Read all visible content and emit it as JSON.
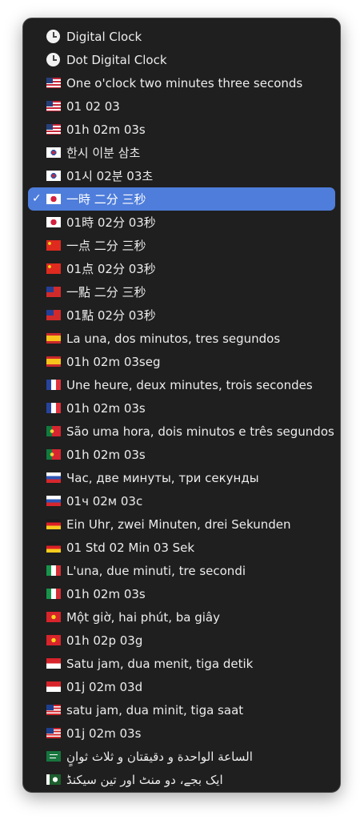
{
  "menu": {
    "check_glyph": "✓",
    "selected_index": 7,
    "accent_color": "#4e7ddb",
    "items": [
      {
        "label": "Digital Clock",
        "icon": "clock-icon"
      },
      {
        "label": "Dot Digital Clock",
        "icon": "clock-icon"
      },
      {
        "label": "One o'clock two minutes three seconds",
        "icon": "flag-us-icon"
      },
      {
        "label": "01 02 03",
        "icon": "flag-us-icon"
      },
      {
        "label": "01h 02m 03s",
        "icon": "flag-us-icon"
      },
      {
        "label": "한시 이분 삼초",
        "icon": "flag-kr-icon"
      },
      {
        "label": "01시 02분 03초",
        "icon": "flag-kr-icon"
      },
      {
        "label": "一時 二分 三秒",
        "icon": "flag-jp-icon"
      },
      {
        "label": "01時 02分 03秒",
        "icon": "flag-jp-icon"
      },
      {
        "label": "一点 二分 三秒",
        "icon": "flag-cn-icon"
      },
      {
        "label": "01点 02分 03秒",
        "icon": "flag-cn-icon"
      },
      {
        "label": "一點 二分 三秒",
        "icon": "flag-tw-icon"
      },
      {
        "label": "01點 02分 03秒",
        "icon": "flag-tw-icon"
      },
      {
        "label": "La una, dos minutos, tres segundos",
        "icon": "flag-es-icon"
      },
      {
        "label": "01h 02m 03seg",
        "icon": "flag-es-icon"
      },
      {
        "label": "Une heure, deux minutes, trois secondes",
        "icon": "flag-fr-icon"
      },
      {
        "label": "01h 02m 03s",
        "icon": "flag-fr-icon"
      },
      {
        "label": "São uma hora, dois minutos e três segundos",
        "icon": "flag-pt-icon"
      },
      {
        "label": "01h 02m 03s",
        "icon": "flag-pt-icon"
      },
      {
        "label": "Час, две минуты, три секунды",
        "icon": "flag-ru-icon"
      },
      {
        "label": "01ч 02м 03с",
        "icon": "flag-ru-icon"
      },
      {
        "label": "Ein Uhr, zwei Minuten, drei Sekunden",
        "icon": "flag-de-icon"
      },
      {
        "label": "01 Std 02 Min 03 Sek",
        "icon": "flag-de-icon"
      },
      {
        "label": "L'una, due minuti, tre secondi",
        "icon": "flag-it-icon"
      },
      {
        "label": "01h 02m 03s",
        "icon": "flag-it-icon"
      },
      {
        "label": "Một giờ, hai phút, ba giây",
        "icon": "flag-vn-icon"
      },
      {
        "label": "01h 02p 03g",
        "icon": "flag-vn-icon"
      },
      {
        "label": "Satu jam, dua menit, tiga detik",
        "icon": "flag-id-icon"
      },
      {
        "label": "01j 02m 03d",
        "icon": "flag-id-icon"
      },
      {
        "label": "satu jam, dua minit, tiga saat",
        "icon": "flag-my-icon"
      },
      {
        "label": "01j 02m 03s",
        "icon": "flag-my-icon"
      },
      {
        "label": "الساعة الواحدة و دقيقتان و ثلاث ثوانٍ",
        "icon": "flag-sa-icon"
      },
      {
        "label": "ایک بجے، دو منٹ اور تین سیکنڈ",
        "icon": "flag-pk-icon"
      }
    ]
  }
}
